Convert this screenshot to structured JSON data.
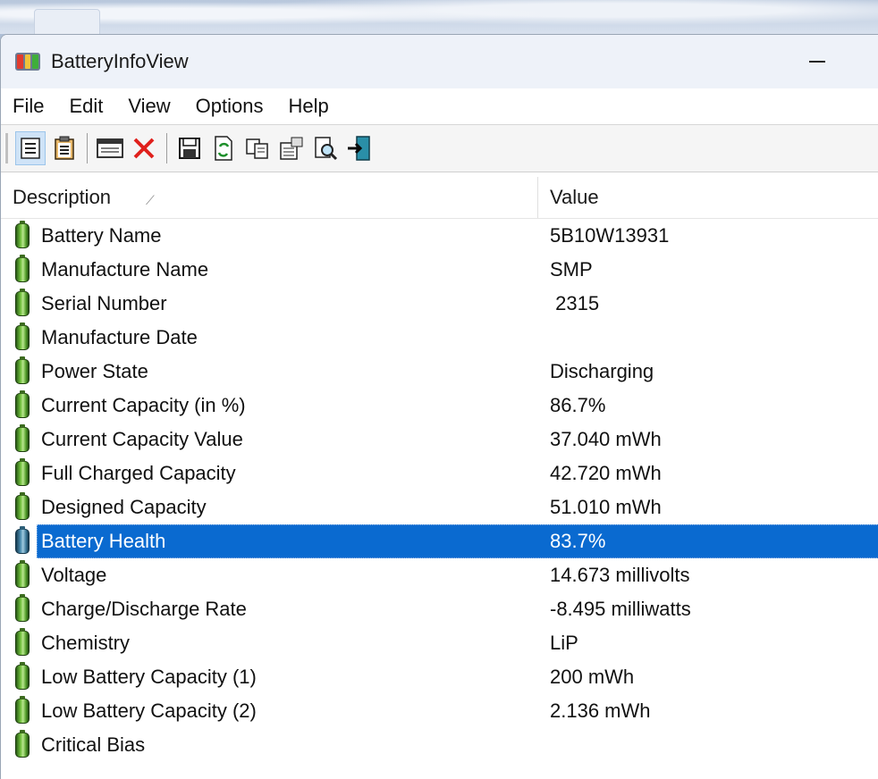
{
  "window": {
    "title": "BatteryInfoView"
  },
  "menubar": {
    "items": [
      "File",
      "Edit",
      "View",
      "Options",
      "Help"
    ]
  },
  "toolbar": {
    "buttons": [
      {
        "icon": "html-report-icon"
      },
      {
        "icon": "properties-icon"
      },
      {
        "icon": "options-window-icon"
      },
      {
        "icon": "delete-icon"
      },
      {
        "icon": "save-icon"
      },
      {
        "icon": "refresh-icon"
      },
      {
        "icon": "copy-icon"
      },
      {
        "icon": "properties-form-icon"
      },
      {
        "icon": "find-icon"
      },
      {
        "icon": "exit-icon"
      }
    ]
  },
  "table": {
    "columns": [
      "Description",
      "Value"
    ],
    "rows": [
      {
        "description": "Battery Name",
        "value": "5B10W13931"
      },
      {
        "description": "Manufacture Name",
        "value": "SMP"
      },
      {
        "description": "Serial Number",
        "value": " 2315"
      },
      {
        "description": "Manufacture Date",
        "value": ""
      },
      {
        "description": "Power State",
        "value": "Discharging"
      },
      {
        "description": "Current Capacity (in %)",
        "value": "86.7%"
      },
      {
        "description": "Current Capacity Value",
        "value": "37.040 mWh"
      },
      {
        "description": "Full Charged Capacity",
        "value": "42.720 mWh"
      },
      {
        "description": "Designed Capacity",
        "value": "51.010 mWh"
      },
      {
        "description": "Battery Health",
        "value": "83.7%",
        "selected": true
      },
      {
        "description": "Voltage",
        "value": "14.673 millivolts"
      },
      {
        "description": "Charge/Discharge Rate",
        "value": "-8.495 milliwatts"
      },
      {
        "description": "Chemistry",
        "value": "LiP"
      },
      {
        "description": "Low Battery Capacity (1)",
        "value": "200 mWh"
      },
      {
        "description": "Low Battery Capacity (2)",
        "value": "2.136 mWh"
      },
      {
        "description": "Critical Bias",
        "value": ""
      }
    ]
  },
  "colors": {
    "selection": "#0a6ad0",
    "battery_green": "#6fbf3b",
    "battery_selected": "#4a8db0"
  }
}
